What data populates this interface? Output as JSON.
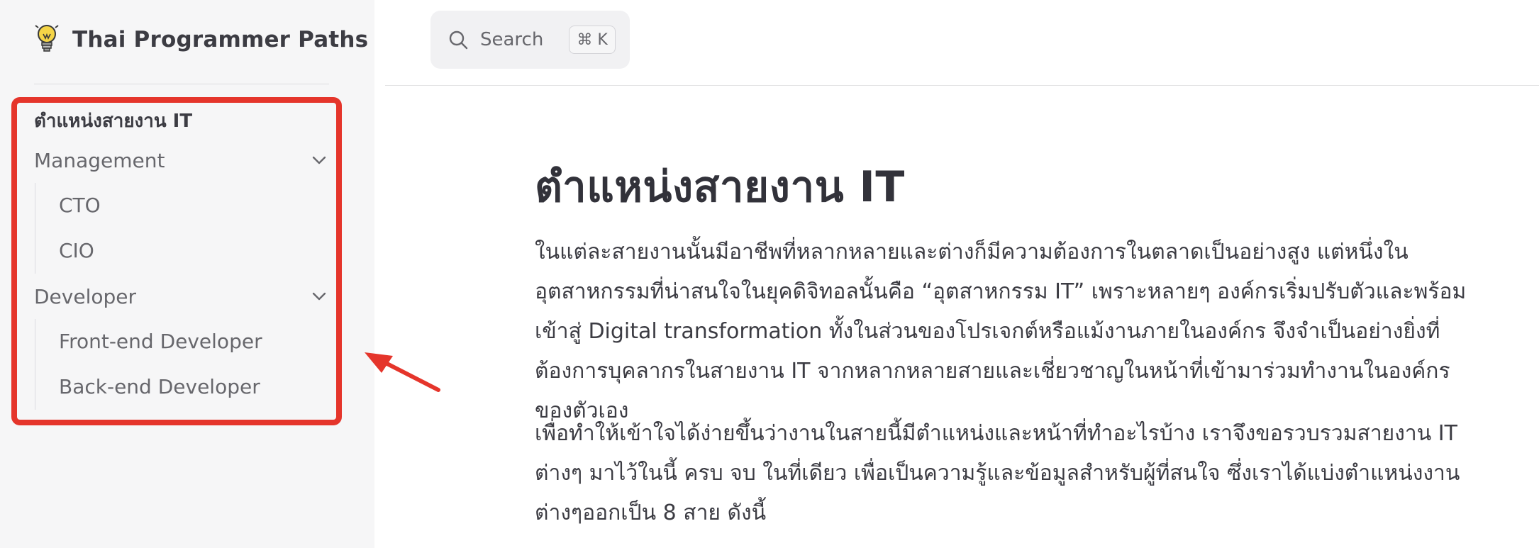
{
  "brand": {
    "title": "Thai Programmer Paths",
    "logo_icon": "lightbulb-icon"
  },
  "search": {
    "label": "Search",
    "shortcut": "⌘ K"
  },
  "sidebar": {
    "heading": "ตำแหน่งสายงาน IT",
    "groups": [
      {
        "label": "Management",
        "items": [
          "CTO",
          "CIO"
        ]
      },
      {
        "label": "Developer",
        "items": [
          "Front-end Developer",
          "Back-end Developer"
        ]
      }
    ]
  },
  "main": {
    "title": "ตำแหน่งสายงาน IT",
    "paragraphs": [
      "ในแต่ละสายงานนั้นมีอาชีพที่หลากหลายและต่างก็มีความต้องการในตลาดเป็นอย่างสูง แต่หนึ่งในอุตสาหกรรมที่น่าสนใจในยุคดิจิทอลนั้นคือ “อุตสาหกรรม IT” เพราะหลายๆ องค์กรเริ่มปรับตัวและพร้อมเข้าสู่ Digital transformation ทั้งในส่วนของโปรเจกต์หรือแม้งานภายในองค์กร จึงจำเป็นอย่างยิ่งที่ต้องการบุคลากรในสายงาน IT จากหลากหลายสายและเชี่ยวชาญในหน้าที่เข้ามาร่วมทำงานในองค์กรของตัวเอง",
      "เพื่อทำให้เข้าใจได้ง่ายขึ้นว่างานในสายนี้มีตำแหน่งและหน้าที่ทำอะไรบ้าง เราจึงขอรวบรวมสายงาน IT ต่างๆ มาไว้ในนี้ ครบ จบ ในที่เดียว เพื่อเป็นความรู้และข้อมูลสำหรับผู้ที่สนใจ ซึ่งเราได้แบ่งตำแหน่งงานต่างๆออกเป็น 8 สาย ดังนี้"
    ]
  },
  "annotation": {
    "highlight_color": "#e5352b"
  }
}
